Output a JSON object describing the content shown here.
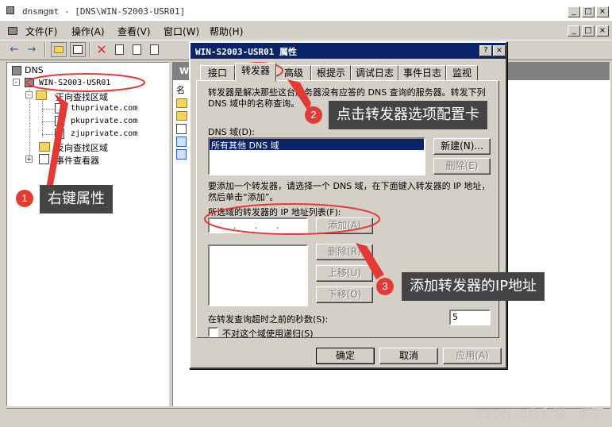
{
  "window": {
    "title": "dnsmgmt - [DNS\\WIN-S2003-USR01]",
    "controls": [
      "_",
      "□",
      "×"
    ],
    "inner_controls": [
      "_",
      "□",
      "×"
    ]
  },
  "menu": [
    "文件(F)",
    "操作(A)",
    "查看(V)",
    "窗口(W)",
    "帮助(H)"
  ],
  "tree": {
    "root": "DNS",
    "server": "WIN-S2003-USR01",
    "forward_zone": "正向查找区域",
    "zones": [
      "thuprivate.com",
      "pkuprivate.com",
      "zjuprivate.com"
    ],
    "reverse_zone": "反向查找区域",
    "event_viewer": "事件查看器"
  },
  "list": {
    "header_tab": "W",
    "col_prefix": "名"
  },
  "dialog": {
    "title": "WIN-S2003-USR01 属性",
    "help": "?",
    "close": "×",
    "tabs": [
      "接口",
      "转发器",
      "高级",
      "根提示",
      "调试日志",
      "事件日志",
      "监视"
    ],
    "active_tab": "转发器",
    "description": "转发器是解决那些这台服务器没有应答的 DNS 查询的服务器。转发下列 DNS 域中的名称查询。",
    "dns_domain_label": "DNS 域(D):",
    "dns_domain_selected": "所有其他 DNS 域",
    "new_button": "新建(N)...",
    "delete_button": "删除(E)",
    "add_hint": "要添加一个转发器，请选择一个 DNS 域，在下面键入转发器的 IP 地址，然后单击“添加”。",
    "ip_list_label": "所选域的转发器的 IP 地址列表(F):",
    "ip_placeholder": " .   .   . ",
    "add_button": "添加(A)",
    "remove_button": "删除(R)",
    "up_button": "上移(U)",
    "down_button": "下移(O)",
    "timeout_label": "在转发查询超时之前的秒数(S):",
    "timeout_value": "5",
    "no_recursion_label": "不对这个域使用递归(S)",
    "ok": "确定",
    "cancel": "取消",
    "apply": "应用(A)"
  },
  "annotations": [
    {
      "num": "1",
      "text": "右键属性"
    },
    {
      "num": "2",
      "text": "点击转发器选项配置卡"
    },
    {
      "num": "3",
      "text": "添加转发器的IP地址"
    }
  ],
  "watermark": "CSDN @你和猫、都要",
  "colors": {
    "accent": "#e53935",
    "title_active": "#0a246a",
    "callout_bg": "#444444"
  }
}
